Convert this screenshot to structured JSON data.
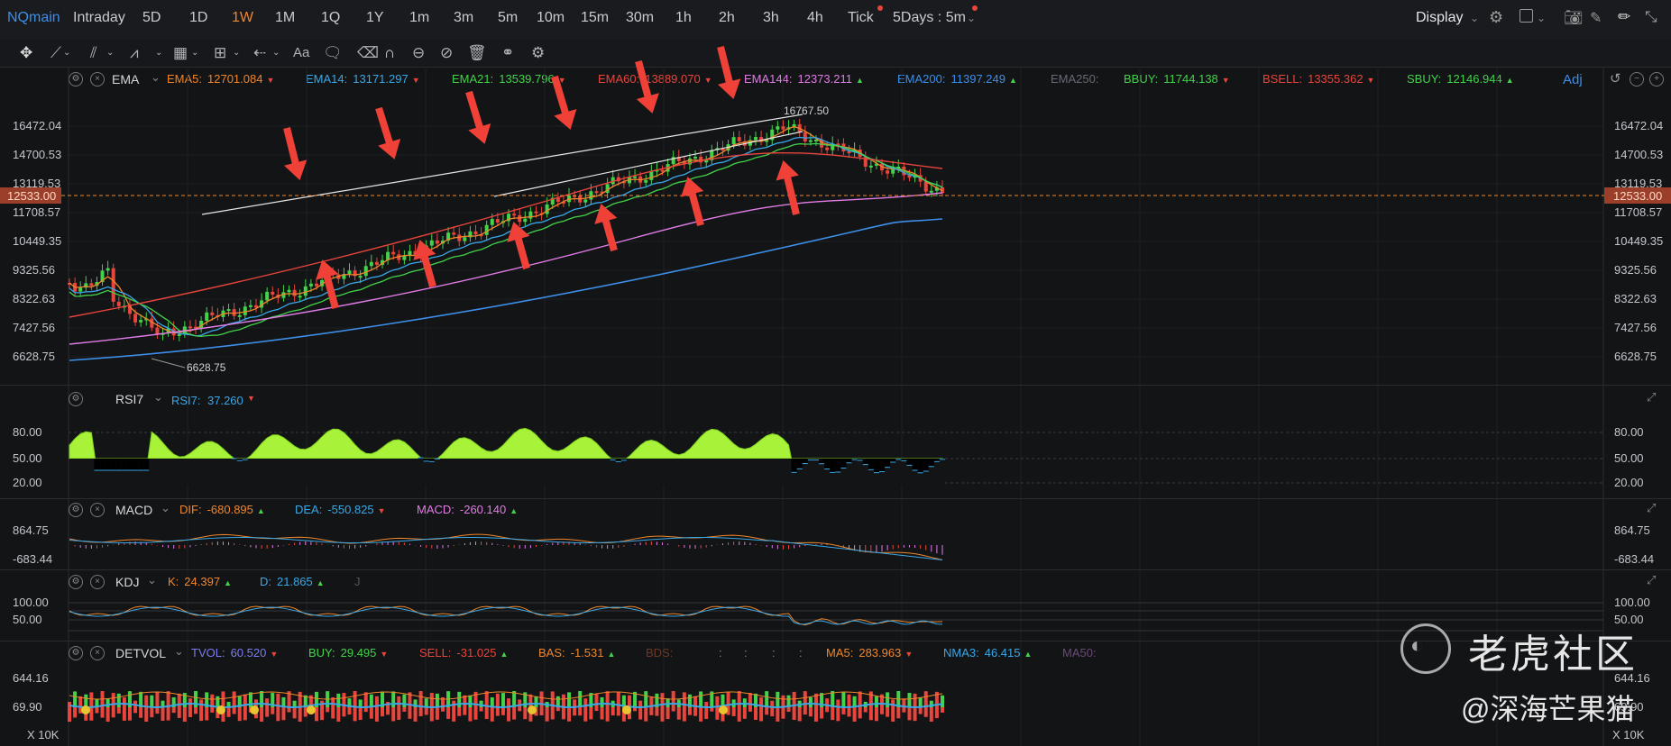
{
  "topbar": {
    "symbol": "NQmain",
    "timeframes": [
      "Intraday",
      "5D",
      "1D",
      "1W",
      "1M",
      "1Q",
      "1Y",
      "1m",
      "3m",
      "5m",
      "10m",
      "15m",
      "30m",
      "1h",
      "2h",
      "3h",
      "4h",
      "Tick"
    ],
    "active": "1W",
    "multi": "5Days : 5m",
    "display": "Display"
  },
  "toolbar": {
    "text_tool": "Aa"
  },
  "main": {
    "indicator": "EMA",
    "legend": [
      {
        "label": "EMA5:",
        "value": "12701.084",
        "color": "#f0862c",
        "dir": "down"
      },
      {
        "label": "EMA14:",
        "value": "13171.297",
        "color": "#39a8e8",
        "dir": "down"
      },
      {
        "label": "EMA21:",
        "value": "13539.796",
        "color": "#43d34a",
        "dir": "down"
      },
      {
        "label": "EMA60:",
        "value": "13889.070",
        "color": "#e8453c",
        "dir": "down"
      },
      {
        "label": "EMA144:",
        "value": "12373.211",
        "color": "#e17ce6",
        "dir": "up"
      },
      {
        "label": "EMA200:",
        "value": "11397.249",
        "color": "#3d8ee8",
        "dir": "up"
      },
      {
        "label": "EMA250:",
        "value": "",
        "color": "#666b73",
        "dir": ""
      },
      {
        "label": "BBUY:",
        "value": "11744.138",
        "color": "#43d34a",
        "dir": "down"
      },
      {
        "label": "BSELL:",
        "value": "13355.362",
        "color": "#e8453c",
        "dir": "down"
      },
      {
        "label": "SBUY:",
        "value": "12146.944",
        "color": "#43d34a",
        "dir": "up"
      }
    ],
    "adj": "Adj",
    "yaxis": [
      "16472.04",
      "14700.53",
      "13119.53",
      "11708.57",
      "10449.35",
      "9325.56",
      "8322.63",
      "7427.56",
      "6628.75"
    ],
    "current_price": "12533.00",
    "high_label": "16767.50",
    "low_label": "6628.75"
  },
  "rsi": {
    "name": "RSI7",
    "value_label": "RSI7:",
    "value": "37.260",
    "dir": "down",
    "yaxis": [
      "80.00",
      "50.00",
      "20.00"
    ]
  },
  "macd": {
    "name": "MACD",
    "legend": [
      {
        "label": "DIF:",
        "value": "-680.895",
        "color": "#f0862c",
        "dir": "up"
      },
      {
        "label": "DEA:",
        "value": "-550.825",
        "color": "#39a8e8",
        "dir": "down"
      },
      {
        "label": "MACD:",
        "value": "-260.140",
        "color": "#e17ce6",
        "dir": "up"
      }
    ],
    "yaxis": [
      "864.75",
      "-683.44"
    ]
  },
  "kdj": {
    "name": "KDJ",
    "legend": [
      {
        "label": "K:",
        "value": "24.397",
        "color": "#f0862c",
        "dir": "up"
      },
      {
        "label": "D:",
        "value": "21.865",
        "color": "#39a8e8",
        "dir": "up"
      },
      {
        "label": "J",
        "value": "",
        "color": "#555",
        "dir": ""
      }
    ],
    "yaxis": [
      "100.00",
      "50.00"
    ]
  },
  "detvol": {
    "name": "DETVOL",
    "legend": [
      {
        "label": "TVOL:",
        "value": "60.520",
        "color": "#7b7df0",
        "dir": "down"
      },
      {
        "label": "BUY:",
        "value": "29.495",
        "color": "#43d34a",
        "dir": "down"
      },
      {
        "label": "SELL:",
        "value": "-31.025",
        "color": "#e8453c",
        "dir": "up"
      },
      {
        "label": "BAS:",
        "value": "-1.531",
        "color": "#f0862c",
        "dir": "up"
      },
      {
        "label": "BDS:",
        "value": "",
        "color": "#6b3a26",
        "dir": ""
      },
      {
        "label": ":",
        "value": "",
        "color": "#888",
        "dir": ""
      },
      {
        "label": ":",
        "value": "",
        "color": "#888",
        "dir": ""
      },
      {
        "label": ":",
        "value": "",
        "color": "#888",
        "dir": ""
      },
      {
        "label": ":",
        "value": "",
        "color": "#888",
        "dir": ""
      },
      {
        "label": "MA5:",
        "value": "283.963",
        "color": "#f0862c",
        "dir": "down"
      },
      {
        "label": "NMA3:",
        "value": "46.415",
        "color": "#39a8e8",
        "dir": "up"
      },
      {
        "label": "MA50:",
        "value": "",
        "color": "#6b4a7a",
        "dir": ""
      }
    ],
    "yaxis": [
      "644.16",
      "69.90"
    ],
    "unit": "X 10K"
  },
  "watermark": {
    "brand": "老虎社区",
    "author": "@深海芒果猫"
  },
  "colors": {
    "up": "#43d34a",
    "down": "#e8453c",
    "accent": "#f0862c",
    "price_line": "#f0862c"
  }
}
